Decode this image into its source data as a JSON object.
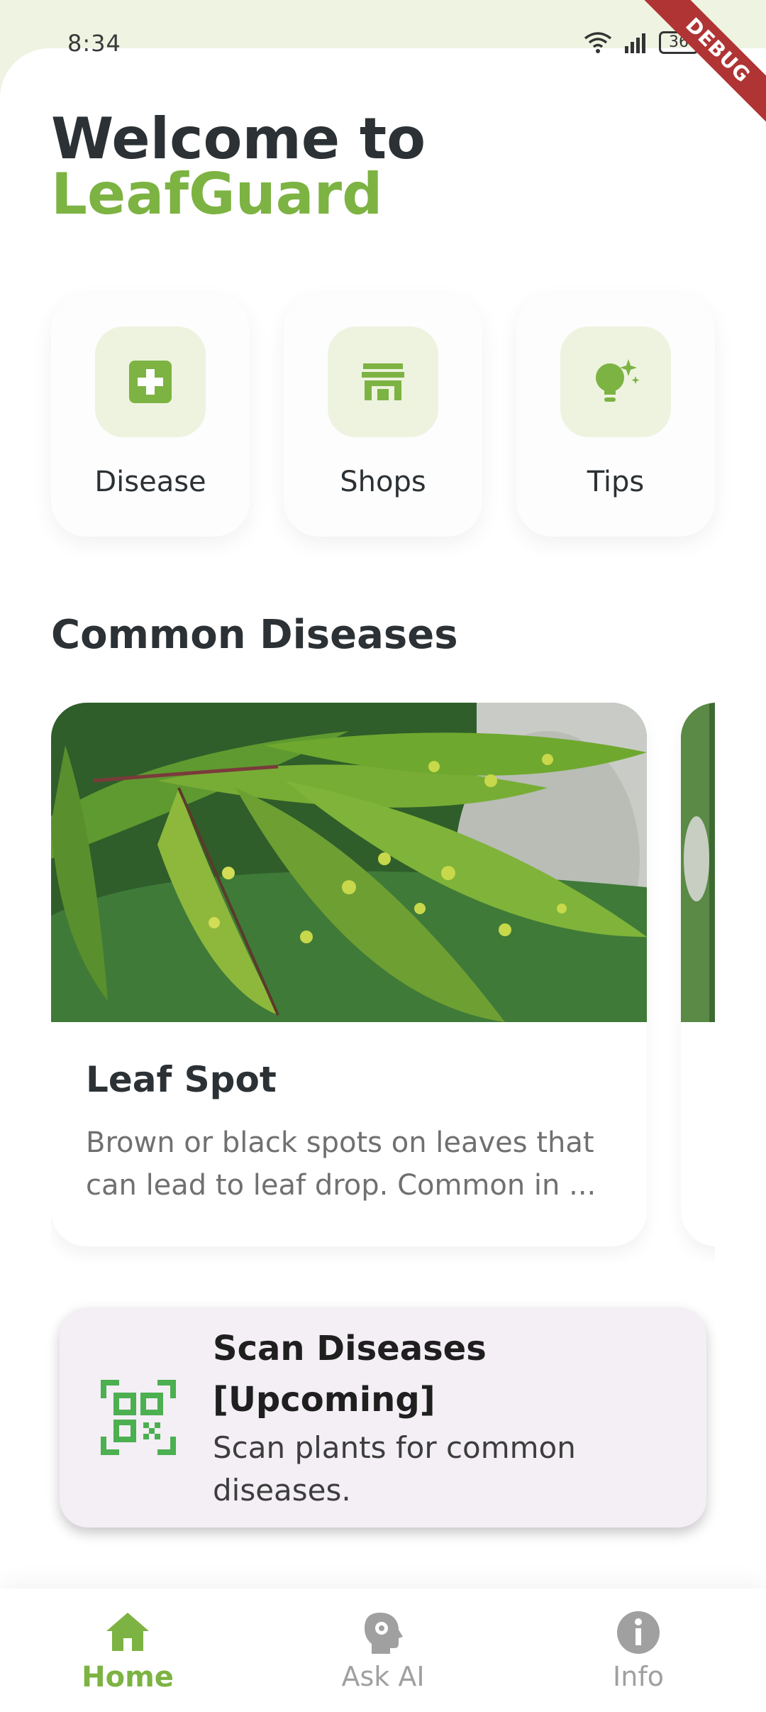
{
  "status_bar": {
    "time": "8:34",
    "battery": "36",
    "debug_label": "DEBUG"
  },
  "header": {
    "welcome": "Welcome to",
    "brand": "LeafGuard"
  },
  "quick_actions": [
    {
      "label": "Disease",
      "icon": "medical-plus-icon"
    },
    {
      "label": "Shops",
      "icon": "storefront-icon"
    },
    {
      "label": "Tips",
      "icon": "lightbulb-icon"
    }
  ],
  "common_diseases": {
    "title": "Common Diseases",
    "items": [
      {
        "name": "Leaf Spot",
        "description": "Brown or black spots on leaves that can lead to leaf drop. Common in ..."
      }
    ]
  },
  "scan_card": {
    "title": "Scan Diseases [Upcoming]",
    "subtitle": "Scan plants for common diseases.",
    "icon": "qr-scan-icon"
  },
  "bottom_nav": {
    "items": [
      {
        "label": "Home",
        "icon": "home-icon",
        "active": true
      },
      {
        "label": "Ask AI",
        "icon": "ai-head-icon",
        "active": false
      },
      {
        "label": "Info",
        "icon": "info-icon",
        "active": false
      }
    ]
  },
  "colors": {
    "brand": "#7cb342",
    "icon_bg": "#edf3df",
    "text_dark": "#2b3134",
    "text_muted": "#707070",
    "inactive": "#a0a0a0",
    "scan_icon": "#4caf50",
    "scan_bg": "#f3eff5",
    "debug": "#b03434"
  }
}
